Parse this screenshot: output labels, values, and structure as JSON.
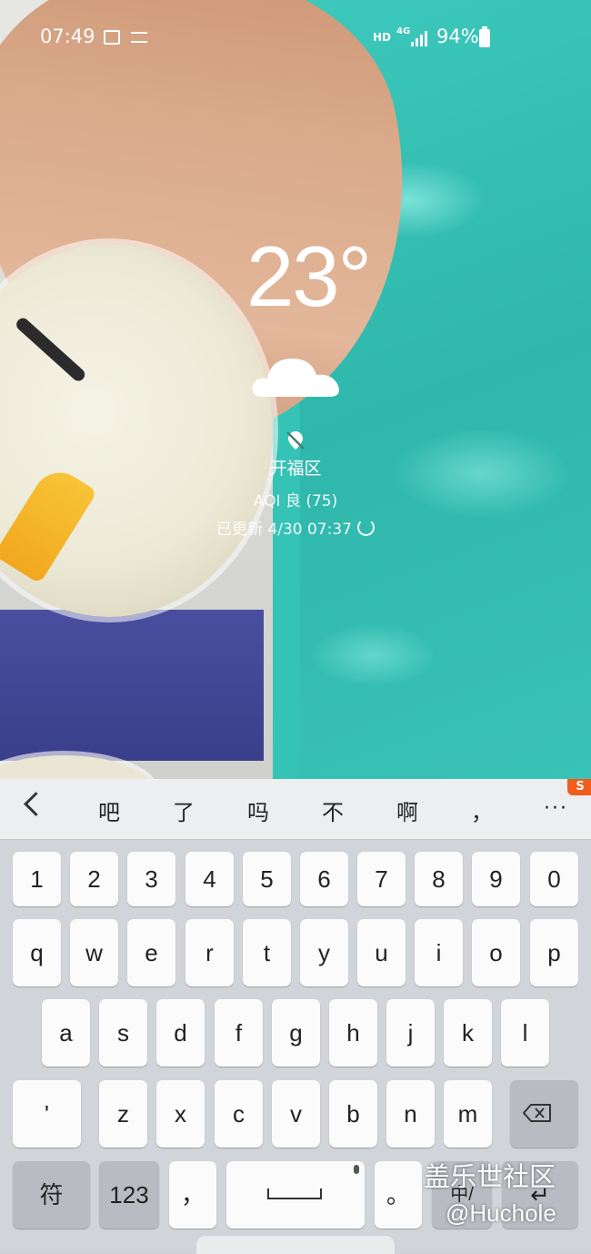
{
  "status_bar": {
    "time": "07:49",
    "network_hd": "HD",
    "network_type": "4G",
    "battery_percent": "94%",
    "icons": [
      "gallery-icon",
      "cast-icon",
      "signal-icon",
      "battery-icon"
    ]
  },
  "weather": {
    "temperature": "23°",
    "condition_icon": "cloud-icon",
    "location": "开福区",
    "aqi": "AQI 良 (75)",
    "updated": "已更新 4/30 07:37"
  },
  "keyboard": {
    "candidates": [
      "吧",
      "了",
      "吗",
      "不",
      "啊",
      "，"
    ],
    "more_label": "···",
    "logo_text": "S",
    "rows": {
      "numbers": [
        "1",
        "2",
        "3",
        "4",
        "5",
        "6",
        "7",
        "8",
        "9",
        "0"
      ],
      "top": [
        "q",
        "w",
        "e",
        "r",
        "t",
        "y",
        "u",
        "i",
        "o",
        "p"
      ],
      "middle": [
        "a",
        "s",
        "d",
        "f",
        "g",
        "h",
        "j",
        "k",
        "l"
      ],
      "bottom": [
        "z",
        "x",
        "c",
        "v",
        "b",
        "n",
        "m"
      ]
    },
    "apostrophe_label": "'",
    "symbols_label": "符",
    "numbers_label": "123",
    "comma_label": "，",
    "period_label": "。",
    "lang_label": "中/",
    "enter_label": "↵"
  },
  "watermark": {
    "main": "盖乐世社区",
    "sub": "@Huchole"
  },
  "colors": {
    "pool": "#35c3b6",
    "keyboard_bg": "#d1d4d8",
    "key_bg": "#fbfbfb",
    "func_key_bg": "#b8bcc2",
    "sogou_orange": "#f25c1a"
  }
}
